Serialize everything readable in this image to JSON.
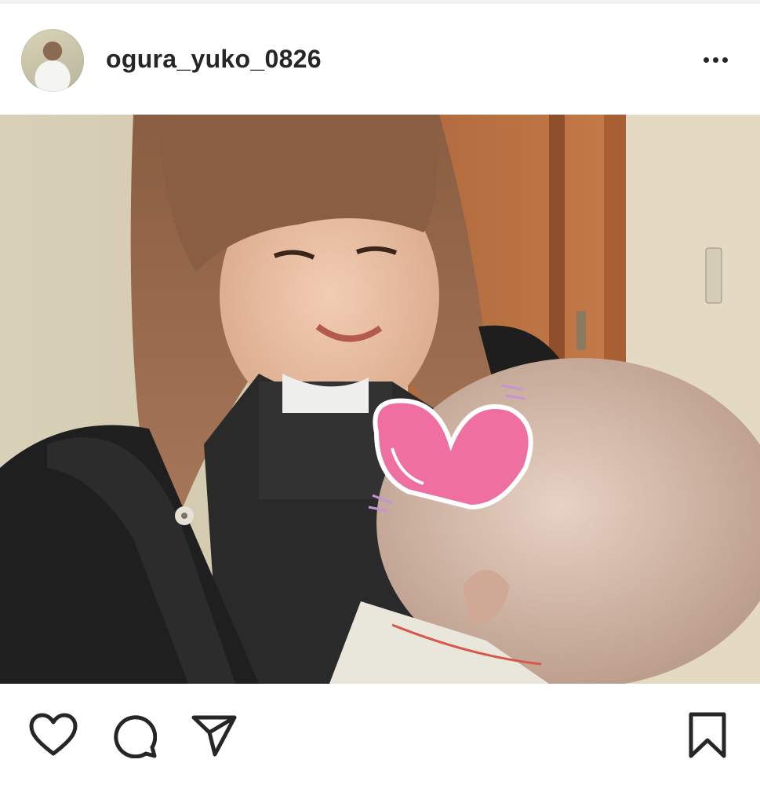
{
  "post": {
    "username": "ogura_yuko_0826"
  },
  "header": {
    "avatar_icon": "profile-avatar",
    "more_icon": "more-options-icon"
  },
  "actions": {
    "like_icon": "heart-outline-icon",
    "comment_icon": "comment-bubble-icon",
    "share_icon": "paper-plane-icon",
    "save_icon": "bookmark-icon"
  },
  "colors": {
    "text": "#262626",
    "background": "#ffffff",
    "heart_sticker": "#ef6fa0"
  }
}
